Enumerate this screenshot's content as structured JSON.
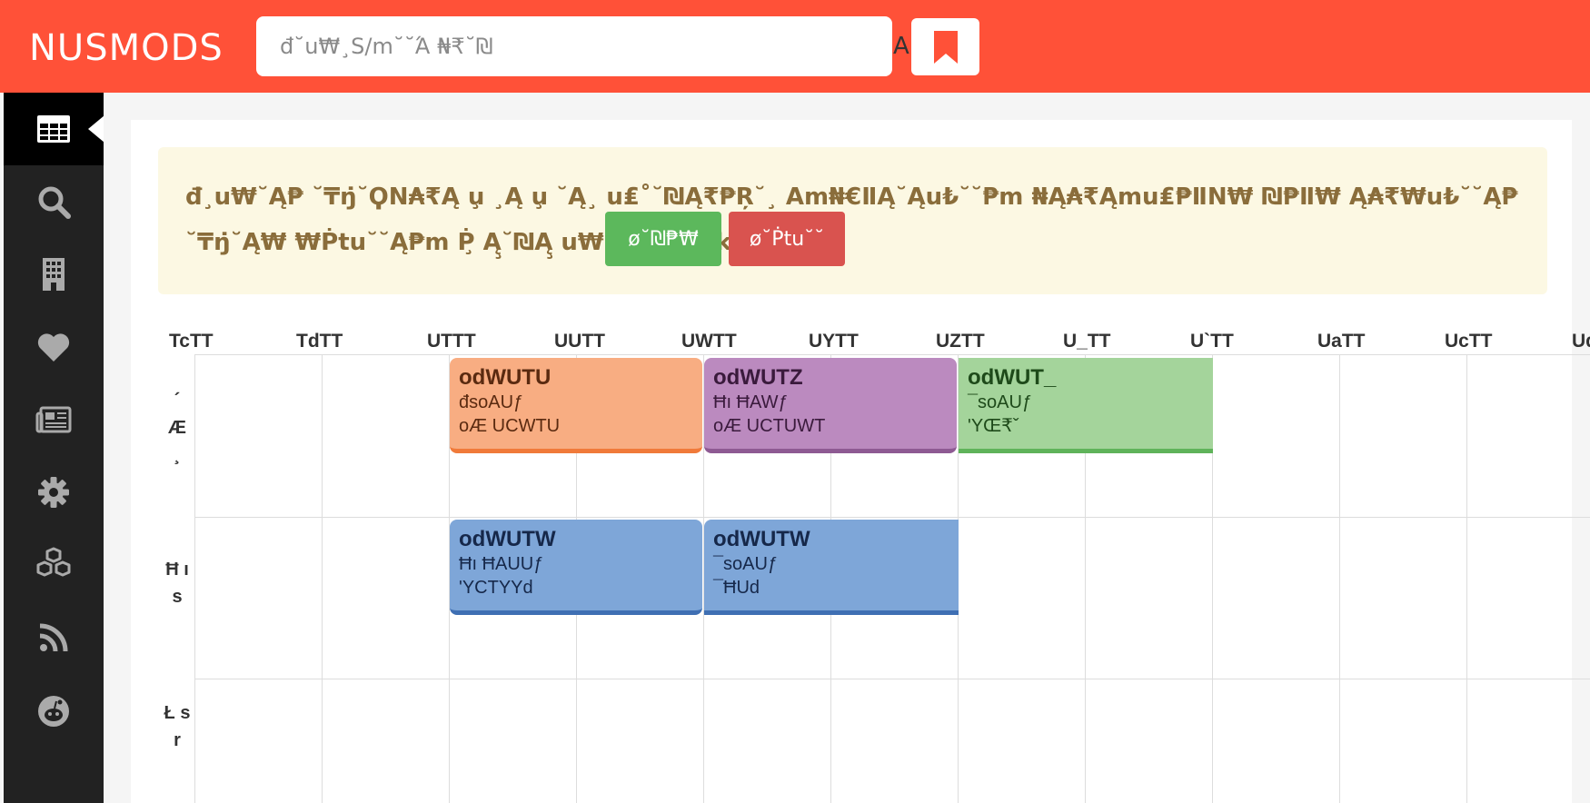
{
  "header": {
    "brand": "NUSMODS",
    "search_placeholder": "đ˘u₩¸Ѕ/ⅿ˘˘Ά ₦₹˘₪",
    "search_trailing": "A"
  },
  "sidebar": {
    "items": [
      {
        "name": "timetable",
        "icon": "grid-icon",
        "active": true
      },
      {
        "name": "search",
        "icon": "search-icon"
      },
      {
        "name": "venues",
        "icon": "building-icon"
      },
      {
        "name": "favourites",
        "icon": "heart-icon"
      },
      {
        "name": "news",
        "icon": "newspaper-icon"
      },
      {
        "name": "settings",
        "icon": "gear-icon"
      },
      {
        "name": "modules",
        "icon": "cubes-icon"
      },
      {
        "name": "rss",
        "icon": "rss-icon"
      },
      {
        "name": "reddit",
        "icon": "reddit-icon"
      }
    ]
  },
  "alert": {
    "text": "đ¸u₩˘Ą₱ ˘₸ŋ̇˘ϘN₳₹Ą u̧ ¸Ą u̧ ˘Ą¸ u₤˚˘₪Ą₹₱Ŗ˘¸ Aⅿ₦€ⅡĄ˘Ąu₺˘˘₱ⅿ ₦Ą₳₹Ąⅿu₤₱ⅡN₩ ₪₱Ⅱ₩ Ą₳₹₩u₺˘˘Ą₱ ˘₸ŋ̇˘Ą₩ ₩Ṗtu˘˘Ą₱ⅿ Ṗ̧ Ą̧˘₪Ą̧ u₩˘Ą₱ ˘₸ŋ̇˘kĄ",
    "ok_label": "ø˘₪₱₩",
    "cancel_label": "ø˘Ṗtu˘˘"
  },
  "timetable": {
    "times": [
      "TcTT",
      "TdTT",
      "UTTT",
      "UUTT",
      "UWTT",
      "UYTT",
      "UZTT",
      "U_TT",
      "U`TT",
      "UaTT",
      "UcTT",
      "Ud"
    ],
    "days": [
      {
        "label": "´ Æ ¸"
      },
      {
        "label": "Ħ ı s"
      },
      {
        "label": "Ł s r"
      }
    ],
    "lessons": [
      {
        "code": "odWUTU",
        "type": "đsoAUƒ",
        "venue": "oÆ UCWTU",
        "color": "#f8ad82",
        "border": "#f07a3a"
      },
      {
        "code": "odWUTZ",
        "type": "Ħı ĦAWƒ",
        "venue": "oÆ UCTUWT",
        "color": "#bb8abf",
        "border": "#8e5a93"
      },
      {
        "code": "odWUT_",
        "type": "¯soAUƒ",
        "venue": "ʹYŒ₹ˇ",
        "color": "#a4d49b",
        "border": "#5fb35a"
      },
      {
        "code": "odWUTW",
        "type": "Ħı ĦAUUƒ",
        "venue": "ʹYCTYYd",
        "color": "#7ea6d8",
        "border": "#3f6fb3"
      },
      {
        "code": "odWUTW",
        "type": "¯soAUƒ",
        "venue": "¯ĦUd",
        "color": "#7ea6d8",
        "border": "#3f6fb3"
      }
    ]
  },
  "colors": {
    "header": "#ff5138",
    "sidebar": "#222222",
    "alert_bg": "#fcf8e3",
    "alert_text": "#8a6d3b",
    "ok": "#5cb85c",
    "cancel": "#d9534f"
  }
}
